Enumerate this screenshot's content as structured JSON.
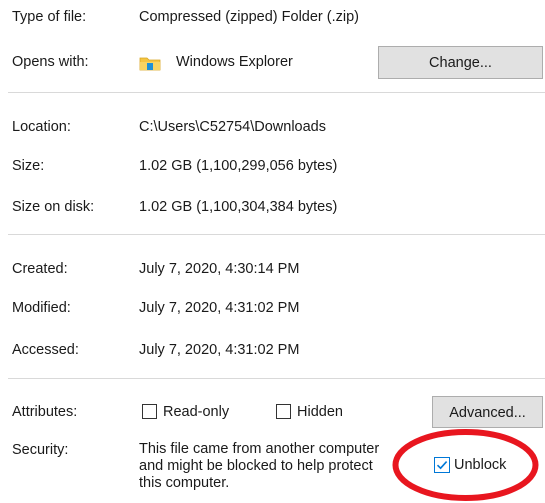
{
  "file_info": {
    "type_label": "Type of file:",
    "type_value": "Compressed (zipped) Folder (.zip)",
    "opens_label": "Opens with:",
    "opens_value": "Windows Explorer",
    "change_button": "Change..."
  },
  "location": {
    "location_label": "Location:",
    "location_value": "C:\\Users\\C52754\\Downloads",
    "size_label": "Size:",
    "size_value": "1.02 GB (1,100,299,056 bytes)",
    "size_on_disk_label": "Size on disk:",
    "size_on_disk_value": "1.02 GB (1,100,304,384 bytes)"
  },
  "dates": {
    "created_label": "Created:",
    "created_value": "July 7, 2020, 4:30:14 PM",
    "modified_label": "Modified:",
    "modified_value": "July 7, 2020, 4:31:02 PM",
    "accessed_label": "Accessed:",
    "accessed_value": "July 7, 2020, 4:31:02 PM"
  },
  "attributes": {
    "label": "Attributes:",
    "read_only_label": "Read-only",
    "read_only_checked": false,
    "hidden_label": "Hidden",
    "hidden_checked": false,
    "advanced_button": "Advanced..."
  },
  "security": {
    "label": "Security:",
    "line1": "This file came from another computer",
    "line2": "and might be blocked to help protect",
    "line3": "this computer.",
    "unblock_label": "Unblock",
    "unblock_checked": true
  },
  "colors": {
    "highlight_circle": "#e8161f",
    "checkbox_accent": "#0078d7",
    "button_bg": "#e1e1e1",
    "folder_yellow": "#f4c542",
    "folder_blue": "#1e90d6"
  },
  "icons": {
    "opens_with_icon": "folder-icon"
  }
}
